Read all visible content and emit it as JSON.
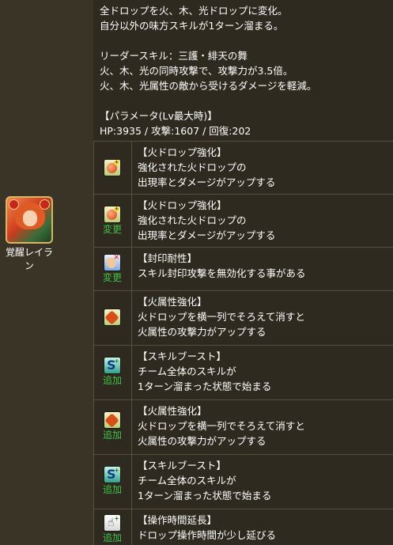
{
  "character": {
    "name": "覚醒レイラン"
  },
  "description": {
    "skill_lines": [
      "全ドロップを火、木、光ドロップに変化。",
      "自分以外の味方スキルが1ターン溜まる。"
    ],
    "leader_lines": [
      "リーダースキル：三護・緋天の舞",
      "火、木、光の同時攻撃で、攻撃力が3.5倍。",
      "火、木、光属性の敵から受けるダメージを軽減。"
    ],
    "param_title": "【パラメータ(Lv最大時)】",
    "param_values": "HP:3935 / 攻撃:1607 / 回復:202"
  },
  "awakenings": [
    {
      "icon": "fire-drop-enhance-icon",
      "tag": "",
      "title": "【火ドロップ強化】",
      "lines": [
        "強化された火ドロップの",
        "出現率とダメージがアップする"
      ]
    },
    {
      "icon": "fire-drop-enhance-icon",
      "tag": "変更",
      "title": "【火ドロップ強化】",
      "lines": [
        "強化された火ドロップの",
        "出現率とダメージがアップする"
      ]
    },
    {
      "icon": "seal-resist-icon",
      "tag": "変更",
      "title": "【封印耐性】",
      "lines": [
        "スキル封印攻撃を無効化する事がある"
      ]
    },
    {
      "icon": "fire-row-enhance-icon",
      "tag": "",
      "title": "【火属性強化】",
      "lines": [
        "火ドロップを横一列でそろえて消すと",
        "火属性の攻撃力がアップする"
      ]
    },
    {
      "icon": "skill-boost-icon",
      "tag": "追加",
      "title": "【スキルブースト】",
      "lines": [
        "チーム全体のスキルが",
        "1ターン溜まった状態で始まる"
      ]
    },
    {
      "icon": "fire-row-enhance-icon",
      "tag": "追加",
      "title": "【火属性強化】",
      "lines": [
        "火ドロップを横一列でそろえて消すと",
        "火属性の攻撃力がアップする"
      ]
    },
    {
      "icon": "skill-boost-icon",
      "tag": "追加",
      "title": "【スキルブースト】",
      "lines": [
        "チーム全体のスキルが",
        "1ターン溜まった状態で始まる"
      ]
    },
    {
      "icon": "extend-time-icon",
      "tag": "追加",
      "title": "【操作時間延長】",
      "lines": [
        "ドロップ操作時間が少し延びる"
      ]
    }
  ],
  "colors": {
    "tag": "#43c04a",
    "background": "#2e2a1f",
    "border": "#574f3c"
  }
}
